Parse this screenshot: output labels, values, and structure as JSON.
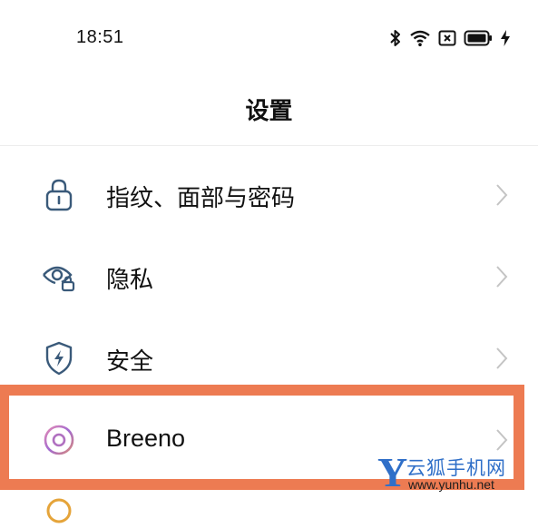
{
  "status_bar": {
    "time": "18:51",
    "icons": [
      "bluetooth-icon",
      "wifi-icon",
      "no-sim-icon",
      "battery-icon",
      "charging-icon"
    ]
  },
  "header": {
    "title": "设置"
  },
  "settings": {
    "items": [
      {
        "label": "指纹、面部与密码",
        "icon": "lock-icon"
      },
      {
        "label": "隐私",
        "icon": "privacy-eye-icon"
      },
      {
        "label": "安全",
        "icon": "security-shield-icon"
      },
      {
        "label": "Breeno",
        "icon": "breeno-icon"
      }
    ]
  },
  "watermark": {
    "letter": "Y",
    "name": "云狐手机网",
    "url": "www.yunhu.net"
  },
  "colors": {
    "highlight": "#ed7b52",
    "icon_blue": "#3a5a7a",
    "chevron": "#c4c4c4",
    "watermark_blue": "#2f6fc8"
  }
}
